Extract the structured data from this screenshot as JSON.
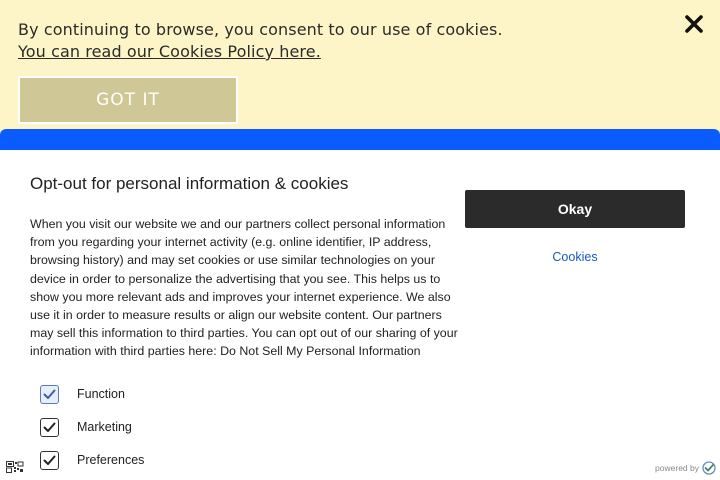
{
  "banner": {
    "message": "By continuing to browse, you consent to our use of cookies.",
    "policy_link": "You can read our Cookies Policy here.",
    "got_it_label": "GOT IT"
  },
  "panel": {
    "title": "Opt-out for personal information & cookies",
    "body": "When you visit our website we and our partners collect personal information from you regarding your internet activity (e.g. online identifier, IP address, browsing history) and may set cookies or use similar technologies on your device in order to personalize the advertising that you see. This helps us to show you more relevant ads and improves your internet experience. We also use it in order to measure results or align our website content. Our partners may sell this information to third parties. You can opt out of our sharing of your information with third parties here: Do Not Sell My Personal Information",
    "okay_label": "Okay",
    "cookies_label": "Cookies",
    "options": [
      {
        "label": "Function",
        "checked": true
      },
      {
        "label": "Marketing",
        "checked": true
      },
      {
        "label": "Preferences",
        "checked": true
      }
    ]
  },
  "footer": {
    "powered_by": "powered by"
  },
  "colors": {
    "banner_bg": "#fdf5c7",
    "got_it_bg": "#cfc796",
    "accent_blue": "#0a5cff",
    "okay_bg": "#2b2b2b",
    "link_blue": "#1a55c9"
  },
  "icons": [
    "close-icon",
    "checkmark-icon",
    "qr-code-icon",
    "verified-check-icon"
  ]
}
